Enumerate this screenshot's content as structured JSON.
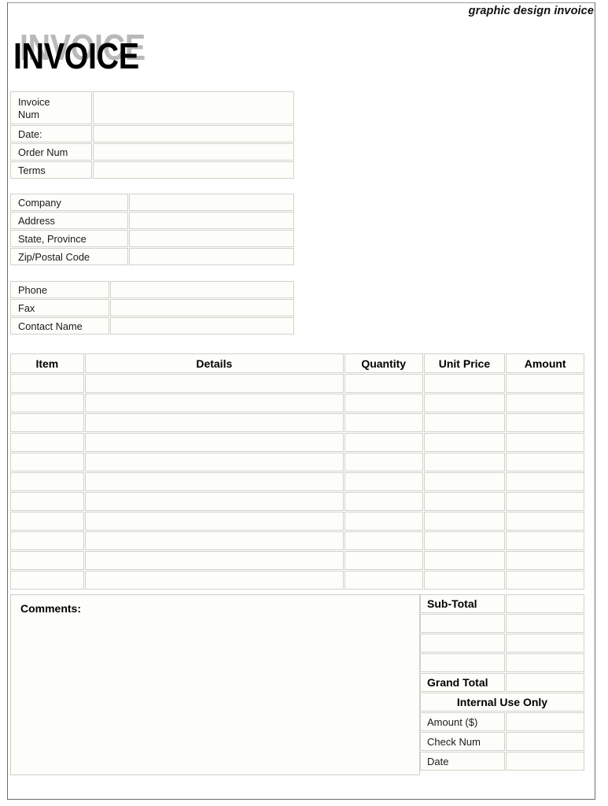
{
  "header": {
    "tagline": "graphic design invoice"
  },
  "title": {
    "text": "INVOICE",
    "shadow_color": "#b9b9b9",
    "solid_color": "#000000"
  },
  "invoice_info": {
    "rows": [
      {
        "label": "Invoice\nNum",
        "value": ""
      },
      {
        "label": "Date:",
        "value": ""
      },
      {
        "label": "Order Num",
        "value": ""
      },
      {
        "label": "Terms",
        "value": ""
      }
    ]
  },
  "billing_info": {
    "rows": [
      {
        "label": "Company",
        "value": ""
      },
      {
        "label": "Address",
        "value": ""
      },
      {
        "label": "State, Province",
        "value": ""
      },
      {
        "label": "Zip/Postal Code",
        "value": ""
      }
    ]
  },
  "contact_info": {
    "rows": [
      {
        "label": "Phone",
        "value": ""
      },
      {
        "label": "Fax",
        "value": ""
      },
      {
        "label": "Contact Name",
        "value": ""
      }
    ]
  },
  "line_items": {
    "columns": [
      "Item",
      "Details",
      "Quantity",
      "Unit Price",
      "Amount"
    ],
    "rows": [
      {
        "item": "",
        "details": "",
        "quantity": "",
        "unit_price": "",
        "amount": ""
      },
      {
        "item": "",
        "details": "",
        "quantity": "",
        "unit_price": "",
        "amount": ""
      },
      {
        "item": "",
        "details": "",
        "quantity": "",
        "unit_price": "",
        "amount": ""
      },
      {
        "item": "",
        "details": "",
        "quantity": "",
        "unit_price": "",
        "amount": ""
      },
      {
        "item": "",
        "details": "",
        "quantity": "",
        "unit_price": "",
        "amount": ""
      },
      {
        "item": "",
        "details": "",
        "quantity": "",
        "unit_price": "",
        "amount": ""
      },
      {
        "item": "",
        "details": "",
        "quantity": "",
        "unit_price": "",
        "amount": ""
      },
      {
        "item": "",
        "details": "",
        "quantity": "",
        "unit_price": "",
        "amount": ""
      },
      {
        "item": "",
        "details": "",
        "quantity": "",
        "unit_price": "",
        "amount": ""
      },
      {
        "item": "",
        "details": "",
        "quantity": "",
        "unit_price": "",
        "amount": ""
      },
      {
        "item": "",
        "details": "",
        "quantity": "",
        "unit_price": "",
        "amount": ""
      }
    ]
  },
  "comments": {
    "label": "Comments:",
    "value": ""
  },
  "totals": {
    "rows": [
      {
        "label": "Sub-Total",
        "value": "",
        "bold": true
      },
      {
        "label": "",
        "value": "",
        "bold": false
      },
      {
        "label": "",
        "value": "",
        "bold": false
      },
      {
        "label": "",
        "value": "",
        "bold": false
      },
      {
        "label": "Grand Total",
        "value": "",
        "bold": true
      }
    ],
    "internal_banner": "Internal Use Only",
    "internal_rows": [
      {
        "label": "Amount ($)",
        "value": ""
      },
      {
        "label": "Check Num",
        "value": ""
      },
      {
        "label": "Date",
        "value": ""
      }
    ]
  }
}
